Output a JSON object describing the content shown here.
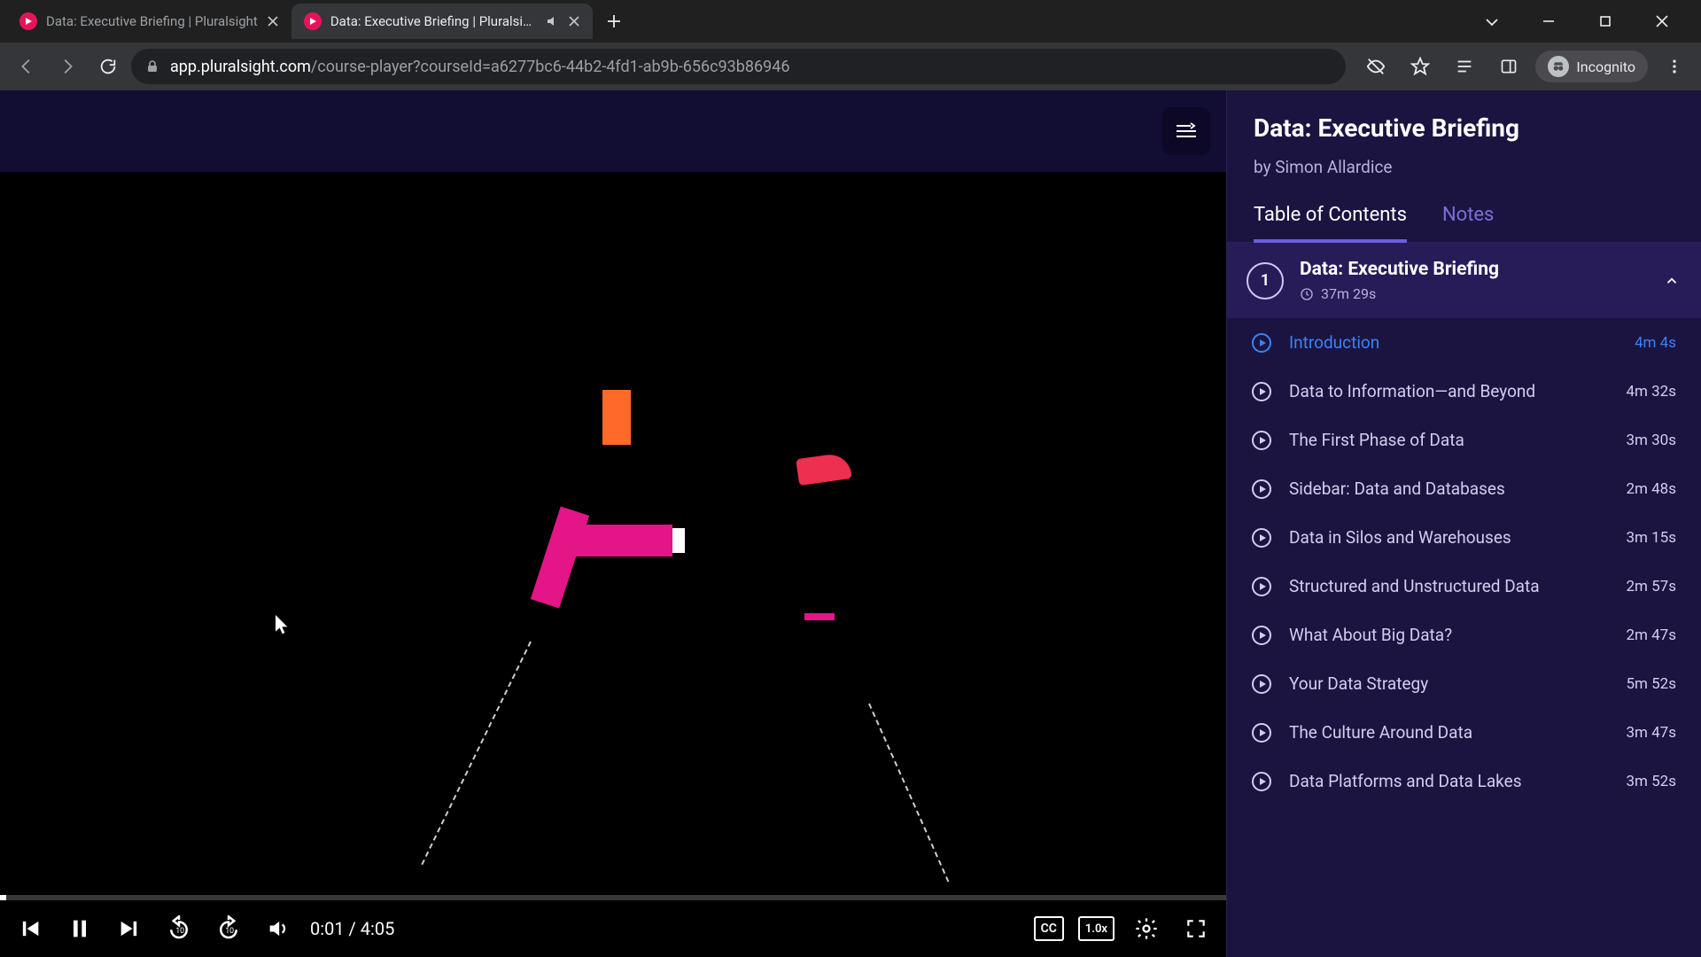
{
  "browser": {
    "tabs": [
      {
        "title": "Data: Executive Briefing | Pluralsight",
        "active": false
      },
      {
        "title": "Data: Executive Briefing | Pluralsight",
        "active": true,
        "audio": true
      }
    ],
    "url_host": "app.pluralsight.com",
    "url_path": "/course-player?courseId=a6277bc6-44b2-4fd1-ab9b-656c93b86946",
    "incognito_label": "Incognito"
  },
  "player": {
    "current_time": "0:01",
    "duration": "4:05",
    "speed_label": "1.0x",
    "cc_label": "CC"
  },
  "sidebar": {
    "course_title": "Data: Executive Briefing",
    "byline": "by Simon Allardice",
    "tabs": {
      "toc": "Table of Contents",
      "notes": "Notes"
    },
    "module": {
      "number": "1",
      "title": "Data: Executive Briefing",
      "duration": "37m 29s"
    },
    "clips": [
      {
        "title": "Introduction",
        "duration": "4m 4s",
        "active": true
      },
      {
        "title": "Data to Information—and Beyond",
        "duration": "4m 32s"
      },
      {
        "title": "The First Phase of Data",
        "duration": "3m 30s"
      },
      {
        "title": "Sidebar: Data and Databases",
        "duration": "2m 48s"
      },
      {
        "title": "Data in Silos and Warehouses",
        "duration": "3m 15s"
      },
      {
        "title": "Structured and Unstructured Data",
        "duration": "2m 57s"
      },
      {
        "title": "What About Big Data?",
        "duration": "2m 47s"
      },
      {
        "title": "Your Data Strategy",
        "duration": "5m 52s"
      },
      {
        "title": "The Culture Around Data",
        "duration": "3m 47s"
      },
      {
        "title": "Data Platforms and Data Lakes",
        "duration": "3m 52s"
      }
    ]
  }
}
